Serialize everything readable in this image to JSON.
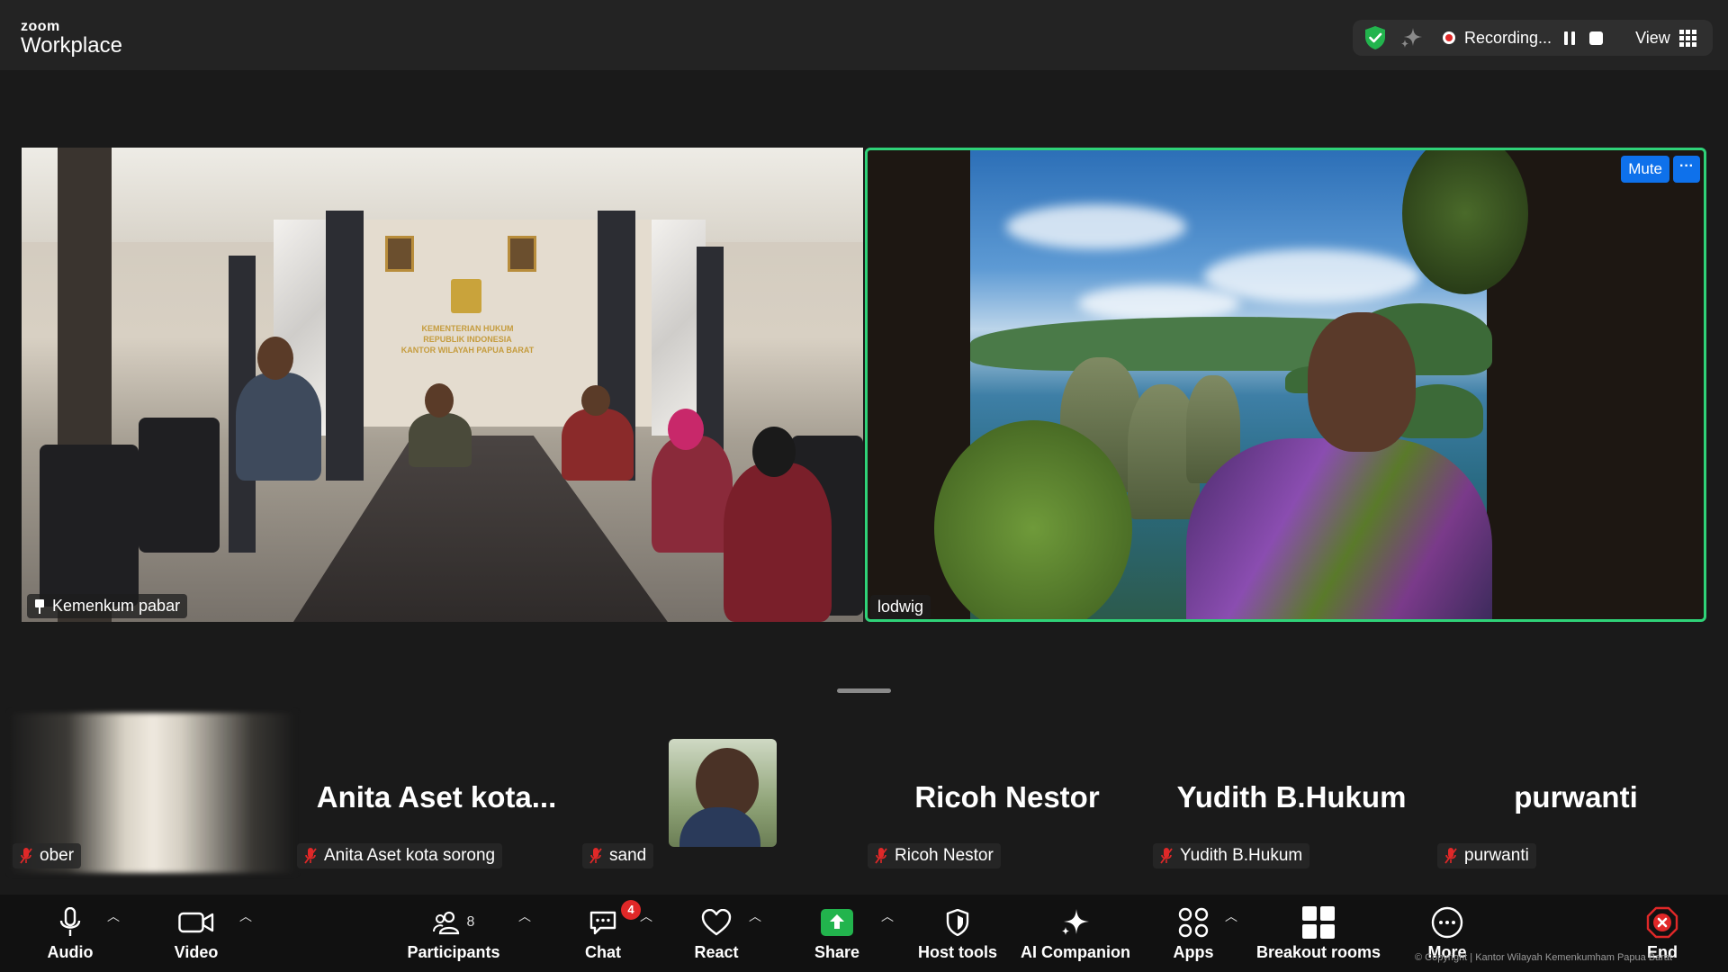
{
  "app": {
    "brand_small": "zoom",
    "brand_large": "Workplace"
  },
  "status_bar": {
    "recording_label": "Recording...",
    "view_label": "View"
  },
  "main_videos": [
    {
      "name": "Kemenkum pabar",
      "wall_text": [
        "KEMENTERIAN HUKUM",
        "REPUBLIK INDONESIA",
        "KANTOR WILAYAH PAPUA BARAT"
      ]
    },
    {
      "name": "lodwig",
      "mute_label": "Mute",
      "more_label": "···"
    }
  ],
  "gallery": [
    {
      "display_name": "",
      "tag": "ober"
    },
    {
      "display_name": "Anita  Aset  kota...",
      "tag": "Anita Aset kota sorong"
    },
    {
      "display_name": "",
      "tag": "sand"
    },
    {
      "display_name": "Ricoh Nestor",
      "tag": "Ricoh Nestor"
    },
    {
      "display_name": "Yudith B.Hukum",
      "tag": "Yudith B.Hukum"
    },
    {
      "display_name": "purwanti",
      "tag": "purwanti"
    }
  ],
  "toolbar": {
    "audio": "Audio",
    "video": "Video",
    "participants": "Participants",
    "participants_count": "8",
    "chat": "Chat",
    "chat_badge": "4",
    "react": "React",
    "share": "Share",
    "host_tools": "Host tools",
    "ai_companion": "AI Companion",
    "apps": "Apps",
    "breakout_rooms": "Breakout rooms",
    "more": "More",
    "end": "End"
  },
  "footer_note": "© Copyright | Kantor Wilayah Kemenkumham Papua Barat",
  "colors": {
    "accent": "#0e71eb",
    "active_speaker": "#2fd278",
    "end_red": "#e02828",
    "share_green": "#22b44d"
  }
}
